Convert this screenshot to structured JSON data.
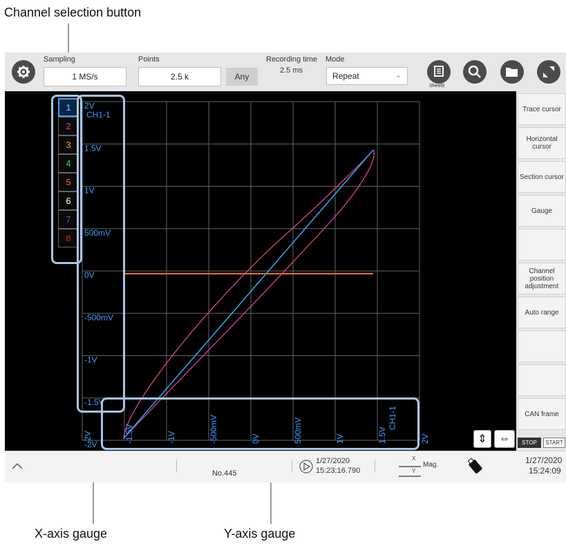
{
  "callouts": {
    "channel_selection": "Channel selection button",
    "x_axis_gauge": "X-axis gauge",
    "y_axis_gauge": "Y-axis gauge"
  },
  "topbar": {
    "sampling_label": "Sampling",
    "sampling_value": "1 MS/s",
    "points_label": "Points",
    "points_value": "2.5 k",
    "any_label": "Any",
    "recording_time_label": "Recording time",
    "recording_time_value": "2.5 ms",
    "mode_label": "Mode",
    "mode_value": "Repeat",
    "sheet_label": "Sheet9",
    "icons": [
      "gear-icon",
      "sheet-icon",
      "search-icon",
      "folder-icon",
      "expand-icon"
    ]
  },
  "channels": [
    {
      "num": "1",
      "color": "#3aa0ff"
    },
    {
      "num": "2",
      "color": "#e0409a"
    },
    {
      "num": "3",
      "color": "#e6b400"
    },
    {
      "num": "4",
      "color": "#41c45a"
    },
    {
      "num": "5",
      "color": "#f07020"
    },
    {
      "num": "6",
      "color": "#ffffff"
    },
    {
      "num": "7",
      "color": "#4a5cd6"
    },
    {
      "num": "8",
      "color": "#e02020"
    }
  ],
  "y_gauge": {
    "channel": "CH1-1",
    "labels": [
      "2V",
      "1.5V",
      "1V",
      "500mV",
      "0V",
      "-500mV",
      "-1V",
      "-1.5V",
      "-2V"
    ]
  },
  "x_gauge": {
    "channel": "CH1-1",
    "labels": [
      "-2V",
      "-1.5V",
      "-1V",
      "-500mV",
      "0V",
      "500mV",
      "1V",
      "1.5V",
      "2V"
    ]
  },
  "sidebar": [
    "Trace cursor",
    "Horizontal\ncursor",
    "Section cursor",
    "Gauge",
    "",
    "Channel\nposition\nadjustment",
    "Auto range",
    "",
    "",
    "CAN frame"
  ],
  "bottom_controls": {
    "stop": "STOP",
    "start": "START"
  },
  "statusbar": {
    "record_no": "No.445",
    "trigger_date": "1/27/2020",
    "trigger_time": "15:23:16.790",
    "mag_label": "Mag.",
    "x_label": "X",
    "y_label": "Y",
    "clock_date": "1/27/2020",
    "clock_time": "15:24:09"
  },
  "colors": {
    "trace_cyan": "#2fa4e0",
    "trace_magenta": "#e0409a",
    "zero_line": "#f07020",
    "highlight": "#a9c6e6"
  }
}
